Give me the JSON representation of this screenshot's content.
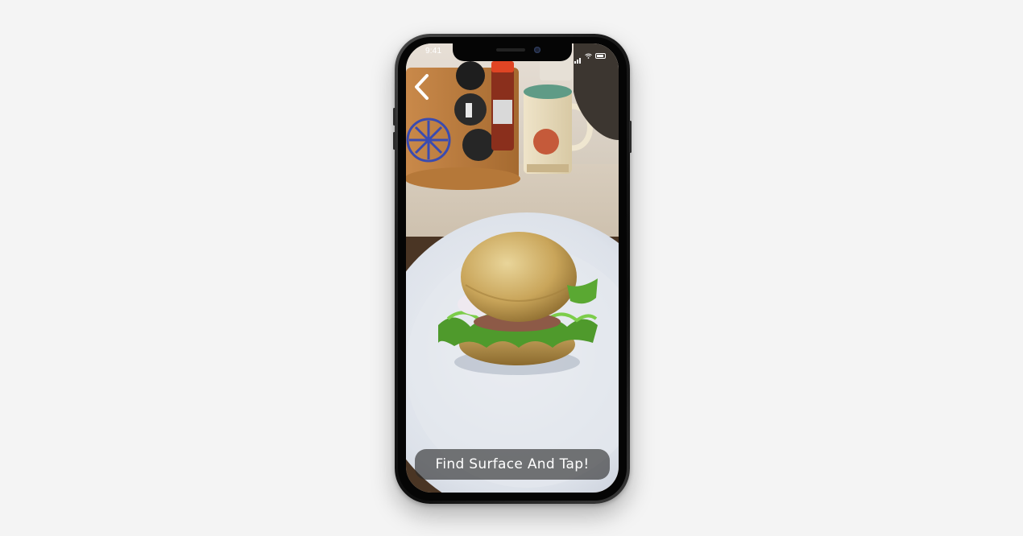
{
  "status_bar": {
    "time": "9:41"
  },
  "ar_view": {
    "back_icon": "chevron-left-icon",
    "model": "hamburger-model",
    "hint": "Find Surface And Tap!"
  },
  "colors": {
    "background": "#f4f4f4",
    "hint_pill": "#282828",
    "hint_text": "#ffffff"
  }
}
